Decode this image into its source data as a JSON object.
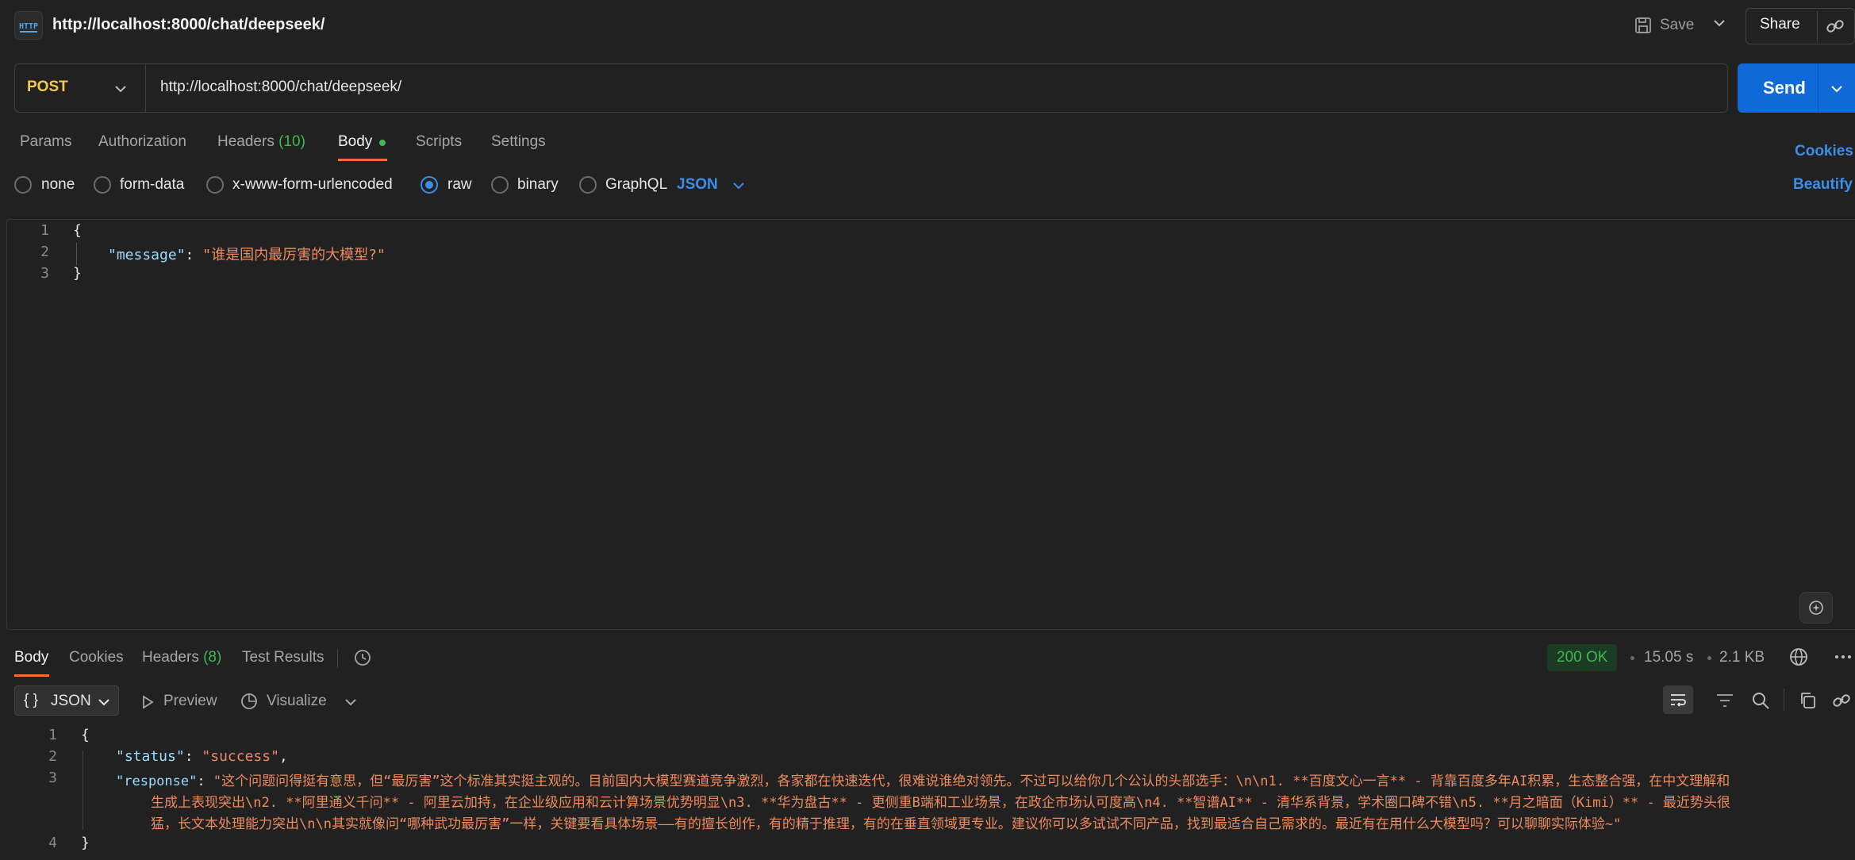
{
  "request": {
    "title": "http://localhost:8000/chat/deepseek/",
    "icon": "http-file-icon",
    "method": "POST",
    "url": "http://localhost:8000/chat/deepseek/"
  },
  "header": {
    "save_label": "Save",
    "share_label": "Share"
  },
  "send": {
    "label": "Send",
    "color": "#0f6ad8"
  },
  "request_tabs": [
    {
      "label": "Params"
    },
    {
      "label": "Authorization"
    },
    {
      "label": "Headers",
      "count": "(10)"
    },
    {
      "label": "Body"
    },
    {
      "label": "Scripts"
    },
    {
      "label": "Settings"
    }
  ],
  "cookies_link": "Cookies",
  "beautify_link": "Beautify",
  "body_types": [
    "none",
    "form-data",
    "x-www-form-urlencoded",
    "raw",
    "binary",
    "GraphQL"
  ],
  "selected_body_type": "raw",
  "raw_format": "JSON",
  "request_body": {
    "line_numbers": [
      "1",
      "2",
      "3"
    ],
    "open_brace": "{",
    "key": "\"message\"",
    "colon": ": ",
    "value": "\"谁是国内最厉害的大模型?\"",
    "close_brace": "}"
  },
  "response_tabs": [
    {
      "label": "Body"
    },
    {
      "label": "Cookies"
    },
    {
      "label": "Headers",
      "count": "(8)"
    },
    {
      "label": "Test Results"
    }
  ],
  "response_meta": {
    "status": "200 OK",
    "time": "15.05 s",
    "size": "2.1 KB"
  },
  "response_toolbar": {
    "format_brace": "{ }",
    "format": "JSON",
    "preview": "Preview",
    "visualize": "Visualize"
  },
  "response_body": {
    "line_numbers": [
      "1",
      "2",
      "3",
      "4"
    ],
    "open_brace": "{",
    "status_key": "\"status\"",
    "status_value": "\"success\"",
    "response_key": "\"response\"",
    "response_line1": "\"这个问题问得挺有意思，但“最厉害”这个标准其实挺主观的。目前国内大模型赛道竞争激烈，各家都在快速迭代，很难说谁绝对领先。不过可以给你几个公认的头部选手：\\n\\n1. **百度文心一言** - 背靠百度多年AI积累，生态整合强，在中文理解和",
    "response_line2": "生成上表现突出\\n2. **阿里通义千问** - 阿里云加持，在企业级应用和云计算场景优势明显\\n3. **华为盘古** - 更侧重B端和工业场景，在政企市场认可度高\\n4. **智谱AI** - 清华系背景，学术圈口碑不错\\n5. **月之暗面（Kimi）** - 最近势头很",
    "response_line3": "猛，长文本处理能力突出\\n\\n其实就像问“哪种武功最厉害”一样，关键要看具体场景——有的擅长创作，有的精于推理，有的在垂直领域更专业。建议你可以多试试不同产品，找到最适合自己需求的。最近有在用什么大模型吗？可以聊聊实际体验~\"",
    "close_brace": "}"
  },
  "colors": {
    "accent_orange": "#ff6c37",
    "link_blue": "#3b8eea",
    "status_green": "#3fb950",
    "method_yellow": "#f6c84c"
  }
}
